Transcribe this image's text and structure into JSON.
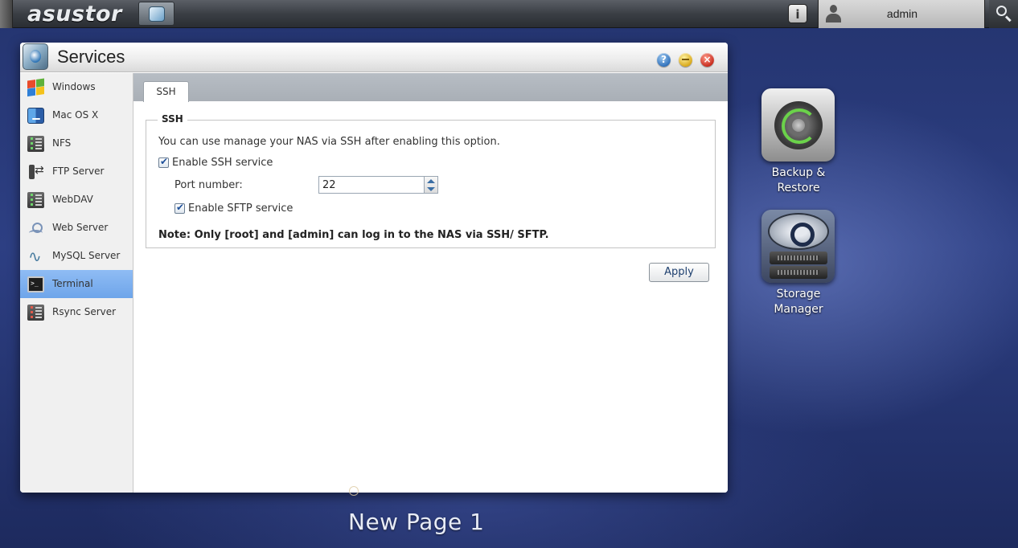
{
  "topbar": {
    "logo_text": "asustor",
    "user_name": "admin",
    "info_icon": "info-icon",
    "search_icon": "search-icon",
    "launcher_icon": "app-launcher-icon"
  },
  "window": {
    "title": "Services",
    "buttons": {
      "help": "?",
      "minimize": "",
      "close": "×"
    }
  },
  "sidebar": {
    "items": [
      {
        "label": "Windows",
        "icon": "windows-icon",
        "active": false
      },
      {
        "label": "Mac OS X",
        "icon": "mac-os-icon",
        "active": false
      },
      {
        "label": "NFS",
        "icon": "nfs-icon",
        "active": false
      },
      {
        "label": "FTP Server",
        "icon": "ftp-icon",
        "active": false
      },
      {
        "label": "WebDAV",
        "icon": "webdav-icon",
        "active": false
      },
      {
        "label": "Web Server",
        "icon": "web-server-icon",
        "active": false
      },
      {
        "label": "MySQL Server",
        "icon": "mysql-icon",
        "active": false
      },
      {
        "label": "Terminal",
        "icon": "terminal-icon",
        "active": true
      },
      {
        "label": "Rsync Server",
        "icon": "rsync-icon",
        "active": false
      }
    ]
  },
  "content": {
    "tabs": [
      {
        "label": "SSH",
        "active": true
      }
    ],
    "ssh": {
      "legend": "SSH",
      "description": "You can use manage your NAS via SSH after enabling this option.",
      "enable_ssh_label": "Enable SSH service",
      "enable_ssh_checked": true,
      "port_label": "Port number:",
      "port_value": "22",
      "enable_sftp_label": "Enable SFTP service",
      "enable_sftp_checked": true,
      "note": "Note: Only [root] and [admin] can log in to the NAS via SSH/ SFTP."
    },
    "apply_label": "Apply"
  },
  "desktop": {
    "icons": [
      {
        "label_line1": "Backup &",
        "label_line2": "Restore",
        "icon": "backup-restore-icon"
      },
      {
        "label_line1": "Storage",
        "label_line2": "Manager",
        "icon": "storage-manager-icon"
      }
    ],
    "page_name": "New Page 1"
  },
  "colors": {
    "active_sidebar": "#7aaeee",
    "desktop_bg": "#2d3f83",
    "apply_text": "#1d3f6e"
  }
}
